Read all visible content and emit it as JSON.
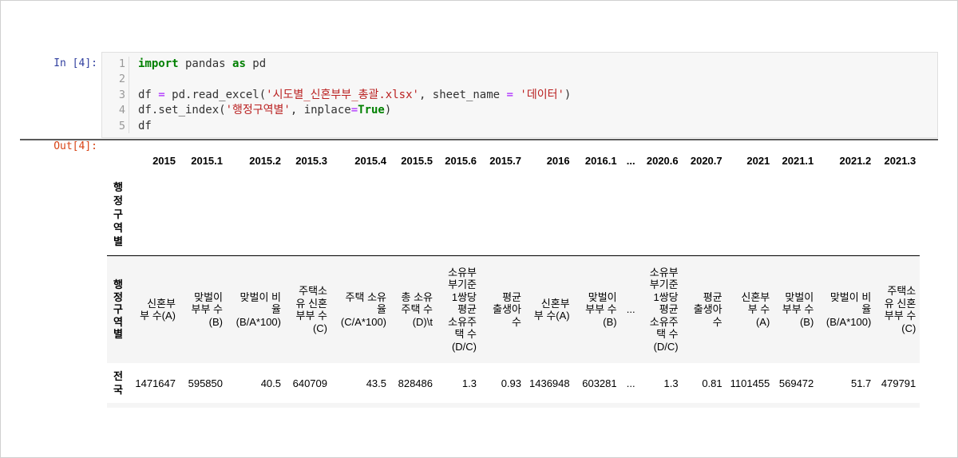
{
  "input_cell": {
    "prompt": "In [4]:",
    "line_numbers": [
      "1",
      "2",
      "3",
      "4",
      "5"
    ]
  },
  "output_cell": {
    "prompt": "Out[4]:"
  },
  "dataframe": {
    "index_name": "행\n정\n구\n역\n별",
    "column_years": [
      "2015",
      "2015.1",
      "2015.2",
      "2015.3",
      "2015.4",
      "2015.5",
      "2015.6",
      "2015.7",
      "2016",
      "2016.1",
      "...",
      "2020.6",
      "2020.7",
      "2021",
      "2021.1",
      "2021.2",
      "2021.3"
    ],
    "row0_index": "행\n정\n구\n역\n별",
    "row0_values": [
      "신혼부\n부 수(A)",
      "맞벌이\n부부 수\n(B)",
      "맞벌이 비\n율\n(B/A*100)",
      "주택소\n유 신혼\n부부 수\n(C)",
      "주택 소유\n율\n(C/A*100)",
      "총 소유\n주택 수\n(D)\\t",
      "소유부\n부기준\n1쌍당\n평균\n소유주\n택 수\n(D/C)",
      "평균\n출생아\n수",
      "신혼부\n부 수(A)",
      "맞벌이\n부부 수\n(B)",
      "...",
      "소유부\n부기준\n1쌍당\n평균\n소유주\n택 수\n(D/C)",
      "평균\n출생아\n수",
      "신혼부\n부 수\n(A)",
      "맞벌이\n부부 수\n(B)",
      "맞벌이 비\n율\n(B/A*100)",
      "주택소\n유 신혼\n부부 수\n(C)"
    ],
    "row1_index": "전\n국",
    "row1_values": [
      "1471647",
      "595850",
      "40.5",
      "640709",
      "43.5",
      "828486",
      "1.3",
      "0.93",
      "1436948",
      "603281",
      "...",
      "1.3",
      "0.81",
      "1101455",
      "569472",
      "51.7",
      "479791"
    ]
  }
}
